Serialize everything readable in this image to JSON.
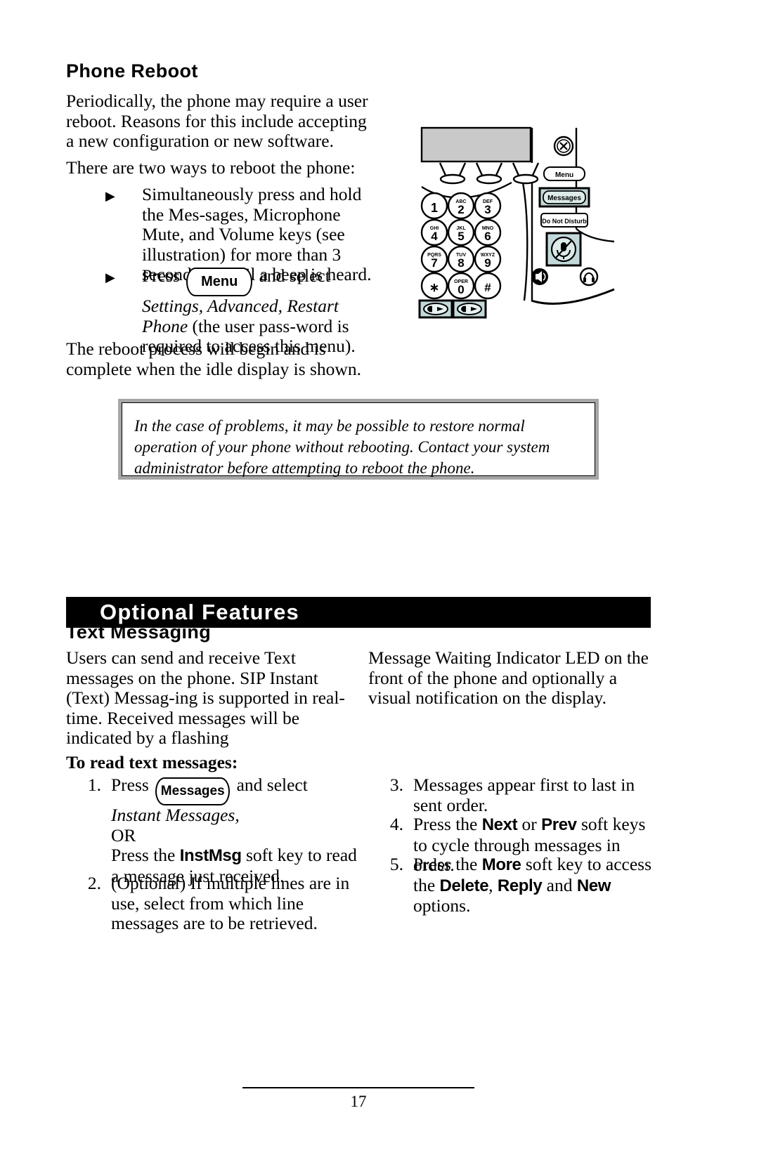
{
  "page": {
    "number": "17",
    "background_color": "#ffffff",
    "text_color": "#000000"
  },
  "section_reboot": {
    "heading": "Phone Reboot",
    "paragraph_1": "Periodically, the phone may require a user reboot.  Reasons for this include accepting a new configuration or new software.",
    "paragraph_2": "There are two ways to reboot the phone:",
    "bullets": [
      {
        "marker": "▶",
        "text": "Simultaneously press and hold the Mes-sages, Microphone Mute, and Volume keys (see illustration) for more than 3 seconds or until a beep is heard."
      },
      {
        "marker": "▶",
        "lead": "Press",
        "keycap": "Menu",
        "mid": "and select",
        "italic": "Settings, Advanced, Restart Phone",
        "tail": "(the user pass-word is required to access this menu)."
      }
    ],
    "paragraph_3": "The reboot process will begin and is complete when the idle display is shown.",
    "note": "In the case of problems, it may be possible to restore normal operation of your phone without rebooting.  Contact your system administrator before attempting to reboot the phone.",
    "note_border_color": "#a6a6a6"
  },
  "phone_illustration": {
    "alt": "Line drawing of IP phone showing Messages, Microphone Mute and Volume keys",
    "display_fill": "#c9c9c9",
    "highlight_fill": "#c3d9d9",
    "soft_key_count": 3,
    "keypad": [
      {
        "digit": "1",
        "letters": ""
      },
      {
        "digit": "2",
        "letters": "ABC"
      },
      {
        "digit": "3",
        "letters": "DEF"
      },
      {
        "digit": "4",
        "letters": "GHI"
      },
      {
        "digit": "5",
        "letters": "JKL"
      },
      {
        "digit": "6",
        "letters": "MNO"
      },
      {
        "digit": "7",
        "letters": "PQRS"
      },
      {
        "digit": "8",
        "letters": "TUV"
      },
      {
        "digit": "9",
        "letters": "WXYZ"
      },
      {
        "digit": "∗",
        "letters": ""
      },
      {
        "digit": "0",
        "letters": "OPER"
      },
      {
        "digit": "#",
        "letters": ""
      }
    ],
    "side_buttons": [
      {
        "name": "cancel",
        "label": "",
        "highlighted": false
      },
      {
        "name": "menu",
        "label": "Menu",
        "highlighted": false
      },
      {
        "name": "messages",
        "label": "Messages",
        "highlighted": true
      },
      {
        "name": "do-not-disturb",
        "label": "Do Not Disturb",
        "highlighted": false
      },
      {
        "name": "microphone-mute",
        "label": "",
        "highlighted": true
      },
      {
        "name": "speaker",
        "label": "",
        "highlighted": false
      },
      {
        "name": "headset",
        "label": "",
        "highlighted": false
      }
    ],
    "volume_keys": {
      "label": "",
      "highlighted": true,
      "count": 2
    }
  },
  "banner": {
    "title": "Optional Features",
    "background_color": "#000000",
    "text_color": "#ffffff"
  },
  "section_text_messaging": {
    "heading": "Text Messaging",
    "intro_left": "Users can send and receive Text messages on the phone.  SIP Instant (Text) Messag-ing is supported in real-time.  Received messages will be indicated by a flashing",
    "intro_right": "Message Waiting Indicator LED on the front of the phone and optionally a visual notification on the display.",
    "subheading": "To read text messages:",
    "steps_left": [
      {
        "number": "1.",
        "lead": "Press",
        "keycap": "Messages",
        "mid": "and select",
        "italic": "Instant Messages,",
        "or": "OR",
        "tail_lead": "Press the",
        "softkey": "InstMsg",
        "tail": "soft key to read a message just received."
      },
      {
        "number": "2.",
        "text": "(Optional)  If multiple lines are in use, select from which line messages are to be retrieved."
      }
    ],
    "steps_right": [
      {
        "number": "3.",
        "text": "Messages appear first to last in sent order."
      },
      {
        "number": "4.",
        "lead": "Press the",
        "softkey_1": "Next",
        "conj": "or",
        "softkey_2": "Prev",
        "tail": "soft keys to cycle through messages in order."
      },
      {
        "number": "5.",
        "lead": "Press the",
        "softkey_1": "More",
        "tail_lead": "soft key to access the",
        "softkey_2": "Delete",
        "sep": ",",
        "softkey_3": "Reply",
        "conj": "and",
        "softkey_4": "New",
        "tail": "options."
      }
    ]
  }
}
